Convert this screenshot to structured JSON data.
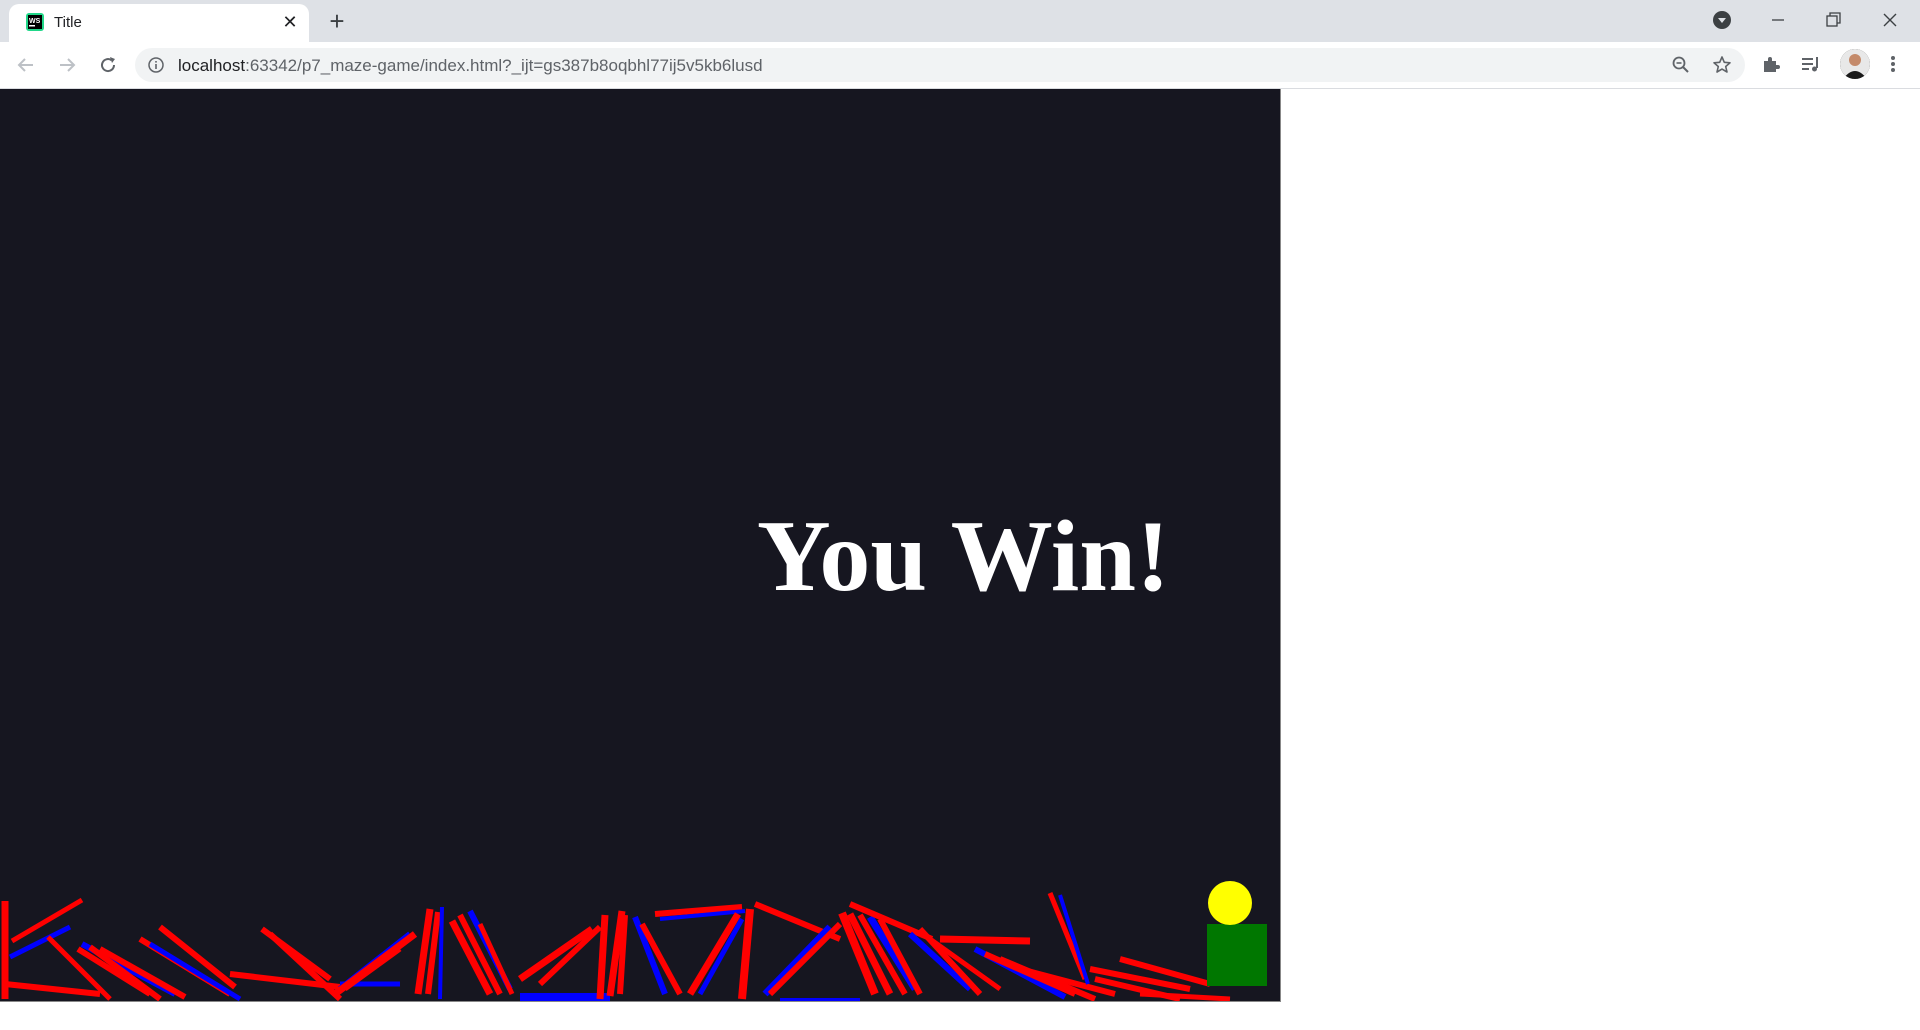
{
  "browser": {
    "tab_title": "Title",
    "url_host": "localhost",
    "url_rest": ":63342/p7_maze-game/index.html?_ijt=gs387b8oqbhl77ij5v5kb6lusd"
  },
  "game": {
    "message": "You Win!",
    "colors": {
      "background": "#161620",
      "wall_primary": "#ff0000",
      "wall_secondary": "#0000ff",
      "ball": "#ffff00",
      "goal": "#007700",
      "text": "#ffffff"
    }
  },
  "icons": {
    "favicon": "webstorm-icon",
    "tab_close": "close-icon",
    "new_tab": "plus-icon",
    "media": "chrome-media-icon",
    "minimize": "minimize-icon",
    "restore": "restore-icon",
    "close_window": "close-icon",
    "back": "arrow-left-icon",
    "forward": "arrow-right-icon",
    "reload": "reload-icon",
    "site_info": "info-icon",
    "zoom": "zoom-out-icon",
    "bookmark": "star-icon",
    "extensions": "puzzle-icon",
    "reading_list": "playlist-icon",
    "menu": "kebab-menu-icon"
  }
}
